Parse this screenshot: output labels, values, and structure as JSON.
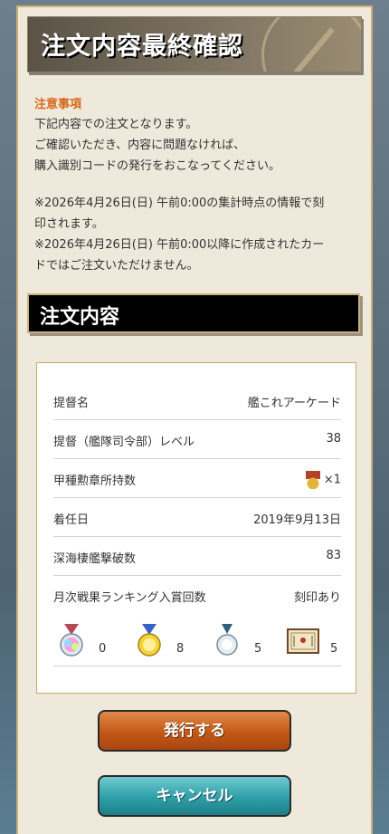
{
  "header": {
    "title": "注文内容最終確認"
  },
  "notice": {
    "heading": "注意事項",
    "line1": "下記内容での注文となります。",
    "line2": "ご確認いただき、内容に問題なければ、",
    "line3": "購入識別コードの発行をおこなってください。",
    "line4": "※2026年4月26日(日) 午前0:00の集計時点の情報で刻",
    "line5": "印されます。",
    "line6": "※2026年4月26日(日) 午前0:00以降に作成されたカー",
    "line7": "ドではご注文いただけません。"
  },
  "section": {
    "title": "注文内容"
  },
  "order": {
    "rows": [
      {
        "label": "提督名",
        "value": "艦これアーケード"
      },
      {
        "label": "提督（艦隊司令部）レベル",
        "value": "38"
      },
      {
        "label": "甲種勲章所持数",
        "value": "×1"
      },
      {
        "label": "着任日",
        "value": "2019年9月13日"
      },
      {
        "label": "深海棲艦撃破数",
        "value": "83"
      },
      {
        "label": "月次戦果ランキング入賞回数",
        "value": "刻印あり"
      }
    ],
    "medals": [
      {
        "icon": "rainbow-medal-icon",
        "count": "0"
      },
      {
        "icon": "gold-medal-icon",
        "count": "8"
      },
      {
        "icon": "silver-medal-icon",
        "count": "5"
      },
      {
        "icon": "certificate-icon",
        "count": "5"
      }
    ]
  },
  "buttons": {
    "issue": "発行する",
    "cancel": "キャンセル"
  }
}
